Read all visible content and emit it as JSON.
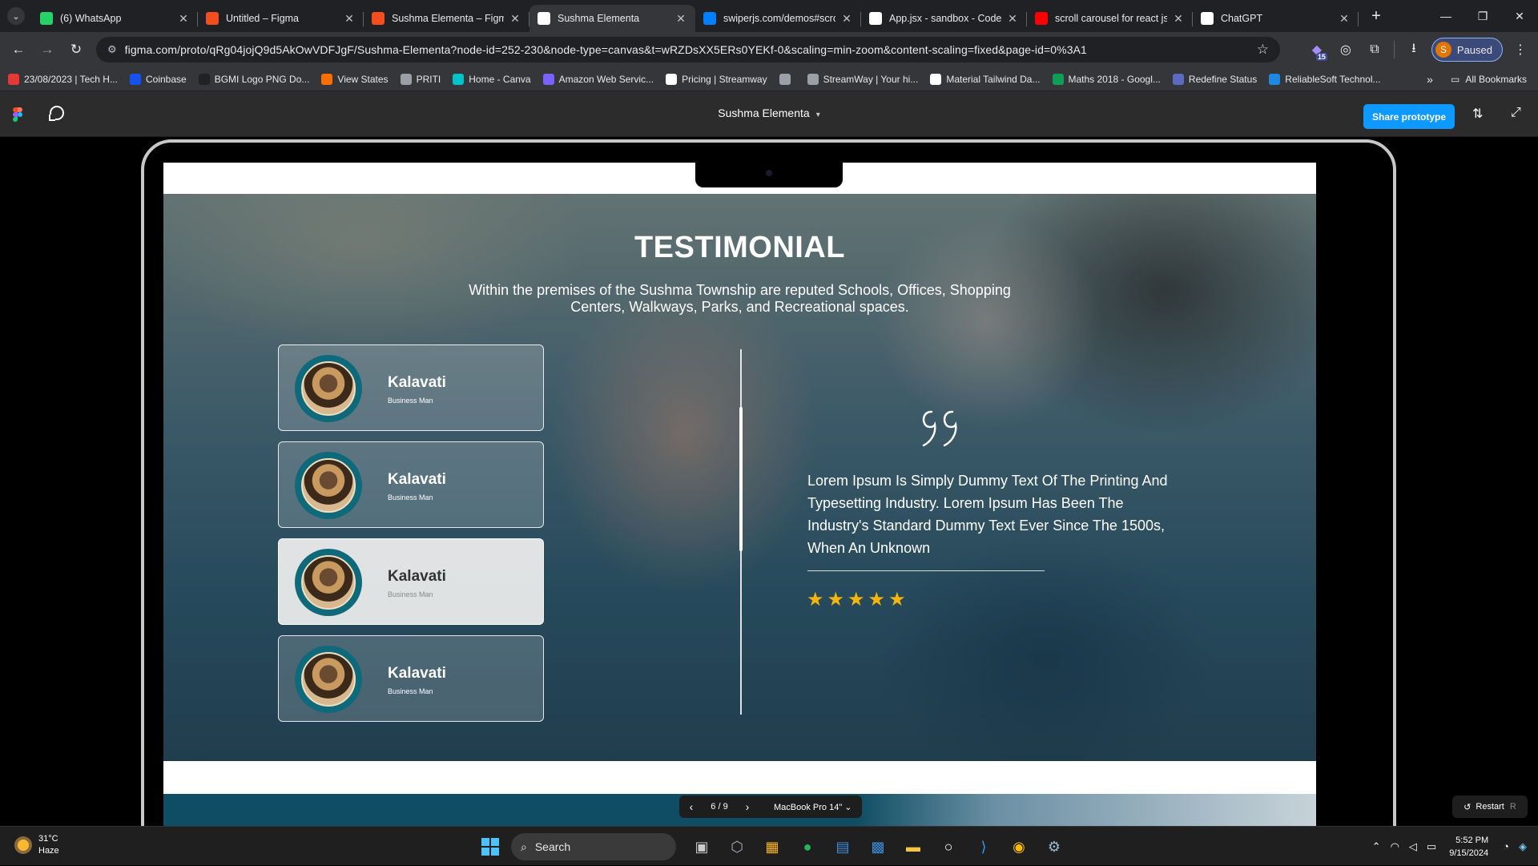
{
  "browser": {
    "tabs": [
      {
        "title": "(6) WhatsApp",
        "icon": "whatsapp-icon",
        "color": "#25d366"
      },
      {
        "title": "Untitled – Figma",
        "icon": "figma-icon",
        "color": "#f24e1e"
      },
      {
        "title": "Sushma Elementa – Figma",
        "icon": "figma-icon",
        "color": "#f24e1e"
      },
      {
        "title": "Sushma Elementa",
        "icon": "play-icon",
        "color": "#ffffff",
        "active": true
      },
      {
        "title": "swiperjs.com/demos#scro",
        "icon": "swiper-icon",
        "color": "#0080ff"
      },
      {
        "title": "App.jsx - sandbox - Code",
        "icon": "codesandbox-icon",
        "color": "#ffffff"
      },
      {
        "title": "scroll carousel for react js",
        "icon": "youtube-icon",
        "color": "#ff0000"
      },
      {
        "title": "ChatGPT",
        "icon": "chatgpt-icon",
        "color": "#ffffff"
      }
    ],
    "url": "figma.com/proto/qRg04jojQ9d5AkOwVDFJgF/Sushma-Elementa?node-id=252-230&node-type=canvas&t=wRZDsXX5ERs0YEKf-0&scaling=min-zoom&content-scaling=fixed&page-id=0%3A1",
    "extension_badge": "15",
    "profile_initial": "S",
    "profile_status": "Paused",
    "bookmarks": [
      {
        "label": "23/08/2023 | Tech H...",
        "color": "#e53935"
      },
      {
        "label": "Coinbase",
        "color": "#1652f0"
      },
      {
        "label": "BGMI Logo PNG Do...",
        "color": "#222222"
      },
      {
        "label": "View States",
        "color": "#ff6d00"
      },
      {
        "label": "PRITI",
        "color": "#9aa0a6"
      },
      {
        "label": "Home - Canva",
        "color": "#00c4cc"
      },
      {
        "label": "Amazon Web Servic...",
        "color": "#7b61ff"
      },
      {
        "label": "Pricing | Streamway",
        "color": "#ffffff"
      },
      {
        "label": "",
        "color": "#9aa0a6"
      },
      {
        "label": "StreamWay | Your hi...",
        "color": "#9aa0a6"
      },
      {
        "label": "Material Tailwind Da...",
        "color": "#ffffff"
      },
      {
        "label": "Maths 2018 - Googl...",
        "color": "#0f9d58"
      },
      {
        "label": "Redefine Status",
        "color": "#5c6bc0"
      },
      {
        "label": "ReliableSoft Technol...",
        "color": "#1e88e5"
      }
    ],
    "all_bookmarks": "All Bookmarks"
  },
  "figma": {
    "title": "Sushma Elementa",
    "share_label": "Share prototype",
    "page_counter": "6 / 9",
    "device": "MacBook Pro 14\"",
    "restart_label": "Restart",
    "restart_key": "R"
  },
  "testimonial": {
    "heading": "TESTIMONIAL",
    "subtext": "Within the premises of the Sushma Township are reputed Schools, Offices, Shopping Centers, Walkways, Parks, and Recreational spaces.",
    "cards": [
      {
        "name": "Kalavati",
        "role": "Business Man",
        "active": false
      },
      {
        "name": "Kalavati",
        "role": "Business Man",
        "active": false
      },
      {
        "name": "Kalavati",
        "role": "Business Man",
        "active": true
      },
      {
        "name": "Kalavati",
        "role": "Business Man",
        "active": false
      }
    ],
    "review": "Lorem Ipsum Is Simply Dummy Text Of The Printing And Typesetting Industry. Lorem Ipsum Has Been The Industry's  Standard Dummy Text Ever Since The 1500s, When An Unknown",
    "rating": 5,
    "star_color": "#f5b50a"
  },
  "taskbar": {
    "temperature": "31°C",
    "weather": "Haze",
    "search_placeholder": "Search",
    "time": "5:52 PM",
    "date": "9/15/2024"
  }
}
